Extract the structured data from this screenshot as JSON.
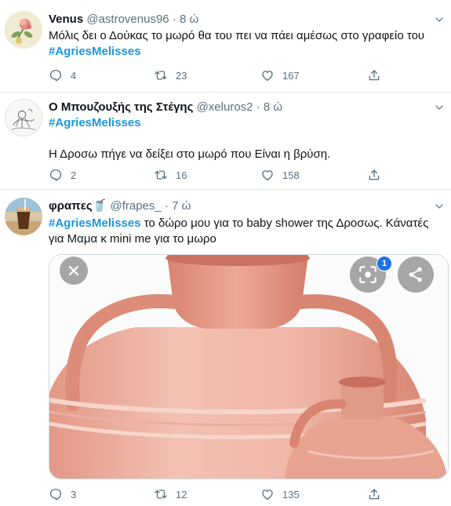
{
  "tweets": [
    {
      "name": "Venus",
      "handle": "@astrovenus96",
      "separator": "·",
      "time": "8 ώ",
      "text": "Μόλις δει ο Δούκας το μωρό θα του πει να πάει αμέσως στο γραφείο του",
      "hashtag": "#AgriesMelisses",
      "replies": "4",
      "retweets": "23",
      "likes": "167"
    },
    {
      "name": "Ο Μπουζουξής της Στέγης",
      "handle": "@xeluros2",
      "separator": "·",
      "time": "8 ώ",
      "hashtag": "#AgriesMelisses",
      "text": "Η Δροσω πήγε να δείξει στο μωρό που Είναι η βρύση.",
      "replies": "2",
      "retweets": "16",
      "likes": "158"
    },
    {
      "name": "φραπες🥤",
      "handle": "@frapes_",
      "separator": "·",
      "time": "7 ώ",
      "hashtag": "#AgriesMelisses",
      "text_line1": " το δώρο μου για το baby shower της Δροσως. Κάνατές",
      "text_line2": "για Μαμα κ mini me για το μωρο",
      "media_badge": "1",
      "replies": "3",
      "retweets": "12",
      "likes": "135"
    }
  ],
  "colors": {
    "link": "#1b95e0",
    "secondary": "#5b7083",
    "clay": "#e8a89a"
  },
  "icons": [
    "reply-icon",
    "retweet-icon",
    "like-icon",
    "share-icon",
    "caret-down-icon",
    "close-icon",
    "lens-icon"
  ]
}
